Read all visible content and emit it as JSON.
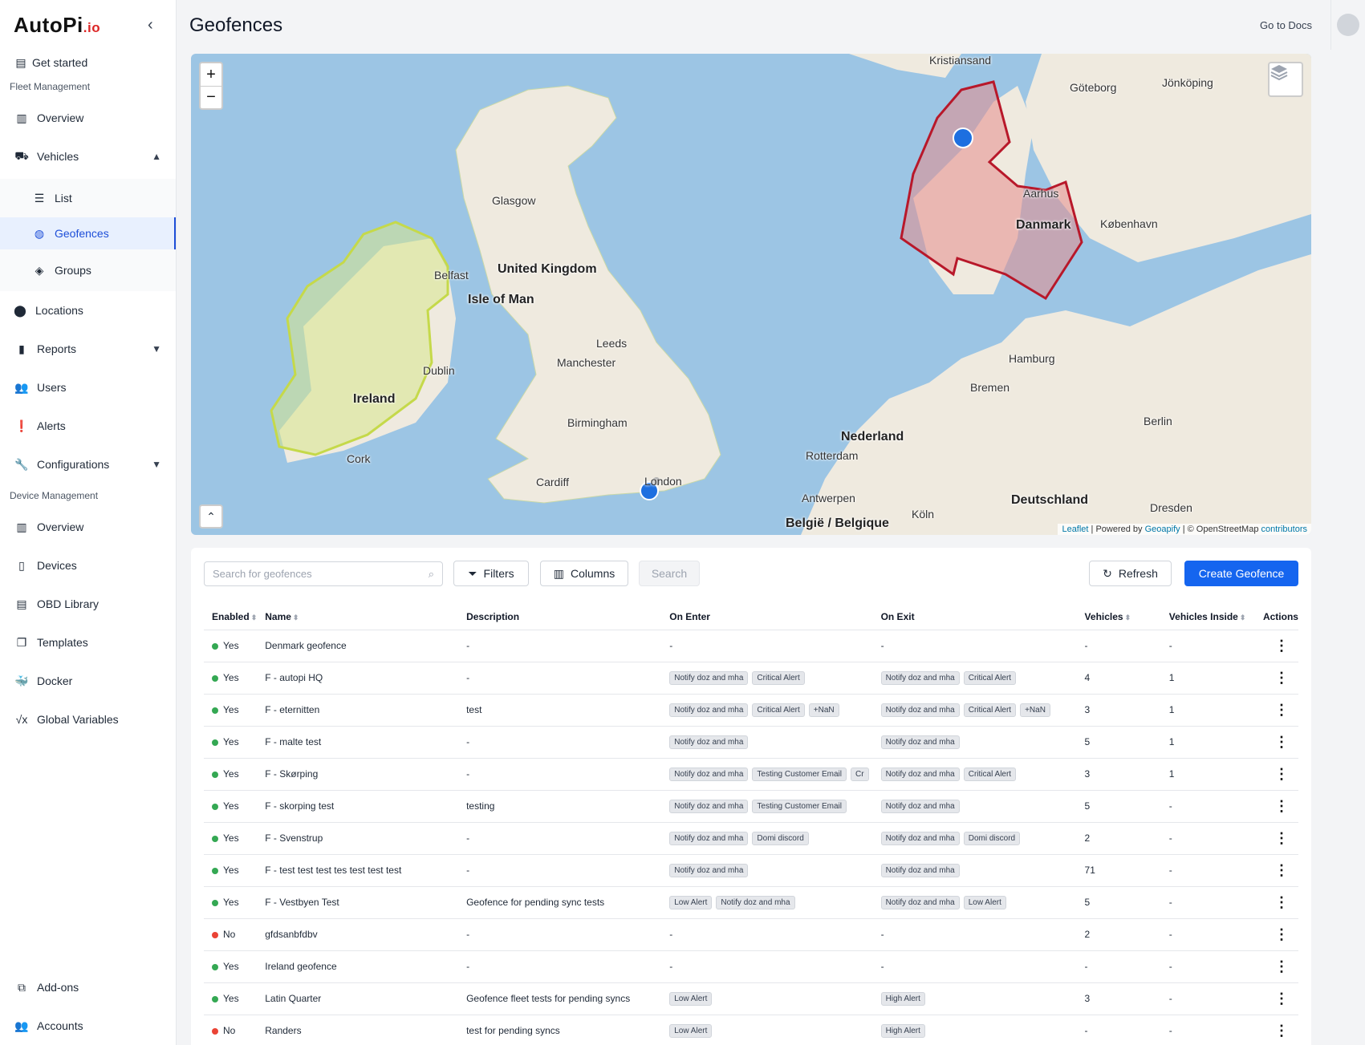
{
  "app": {
    "logo_main": "AutoPi",
    "logo_suffix": ".io"
  },
  "sidebar": {
    "get_started": "Get started",
    "fleet_section": "Fleet Management",
    "fleet_overview": "Overview",
    "vehicles": "Vehicles",
    "list": "List",
    "geofences": "Geofences",
    "groups": "Groups",
    "locations": "Locations",
    "reports": "Reports",
    "users": "Users",
    "alerts": "Alerts",
    "configurations": "Configurations",
    "device_section": "Device Management",
    "device_overview": "Overview",
    "devices": "Devices",
    "obd_library": "OBD Library",
    "templates": "Templates",
    "docker": "Docker",
    "global_variables": "Global Variables",
    "addons": "Add-ons",
    "accounts": "Accounts"
  },
  "header": {
    "title": "Geofences",
    "docs_link": "Go to Docs"
  },
  "map": {
    "zoom_in": "+",
    "zoom_out": "−",
    "attribution": {
      "leaflet": "Leaflet",
      "powered": "| Powered by",
      "geoapify": "Geoapify",
      "osm": "| © OpenStreetMap",
      "contributors": "contributors"
    },
    "labels": {
      "kristiansand": "Kristiansand",
      "goteborg": "Göteborg",
      "jonkoping": "Jönköping",
      "glasgow": "Glasgow",
      "uk": "United Kingdom",
      "belfast": "Belfast",
      "isle_of_man": "Isle of Man",
      "aarhus": "Aarhus",
      "danmark": "Danmark",
      "kobenhavn": "København",
      "leeds": "Leeds",
      "manchester": "Manchester",
      "hamburg": "Hamburg",
      "dublin": "Dublin",
      "ireland": "Ireland",
      "bremen": "Bremen",
      "birmingham": "Birmingham",
      "berlin": "Berlin",
      "nederland": "Nederland",
      "cork": "Cork",
      "rotterdam": "Rotterdam",
      "cardiff": "Cardiff",
      "london": "London",
      "antwerpen": "Antwerpen",
      "deutschland": "Deutschland",
      "dresden": "Dresden",
      "koln": "Köln",
      "belgie": "België / Belgique"
    }
  },
  "toolbar": {
    "search_placeholder": "Search for geofences",
    "filters": "Filters",
    "columns": "Columns",
    "search": "Search",
    "refresh": "Refresh",
    "create": "Create Geofence"
  },
  "table": {
    "headers": {
      "enabled": "Enabled",
      "name": "Name",
      "description": "Description",
      "on_enter": "On Enter",
      "on_exit": "On Exit",
      "vehicles": "Vehicles",
      "vehicles_inside": "Vehicles Inside",
      "actions": "Actions"
    },
    "rows": [
      {
        "enabled": "Yes",
        "status": "green",
        "name": "Denmark geofence",
        "description": "-",
        "on_enter": [],
        "on_enter_text": "-",
        "on_exit": [],
        "on_exit_text": "-",
        "vehicles": "-",
        "inside": "-"
      },
      {
        "enabled": "Yes",
        "status": "green",
        "name": "F - autopi HQ",
        "description": "-",
        "on_enter": [
          "Notify doz and mha",
          "Critical Alert"
        ],
        "on_enter_text": "",
        "on_exit": [
          "Notify doz and mha",
          "Critical Alert"
        ],
        "on_exit_text": "",
        "vehicles": "4",
        "inside": "1"
      },
      {
        "enabled": "Yes",
        "status": "green",
        "name": "F - eternitten",
        "description": "test",
        "on_enter": [
          "Notify doz and mha",
          "Critical Alert",
          "+NaN"
        ],
        "on_enter_text": "",
        "on_exit": [
          "Notify doz and mha",
          "Critical Alert",
          "+NaN"
        ],
        "on_exit_text": "",
        "vehicles": "3",
        "inside": "1"
      },
      {
        "enabled": "Yes",
        "status": "green",
        "name": "F - malte test",
        "description": "-",
        "on_enter": [
          "Notify doz and mha"
        ],
        "on_enter_text": "",
        "on_exit": [
          "Notify doz and mha"
        ],
        "on_exit_text": "",
        "vehicles": "5",
        "inside": "1"
      },
      {
        "enabled": "Yes",
        "status": "green",
        "name": "F - Skørping",
        "description": "-",
        "on_enter": [
          "Notify doz and mha",
          "Testing Customer Email",
          "Cr"
        ],
        "on_enter_text": "",
        "on_exit": [
          "Notify doz and mha",
          "Critical Alert"
        ],
        "on_exit_text": "",
        "vehicles": "3",
        "inside": "1"
      },
      {
        "enabled": "Yes",
        "status": "green",
        "name": "F - skorping test",
        "description": "testing",
        "on_enter": [
          "Notify doz and mha",
          "Testing Customer Email"
        ],
        "on_enter_text": "",
        "on_exit": [
          "Notify doz and mha"
        ],
        "on_exit_text": "",
        "vehicles": "5",
        "inside": "-"
      },
      {
        "enabled": "Yes",
        "status": "green",
        "name": "F - Svenstrup",
        "description": "-",
        "on_enter": [
          "Notify doz and mha",
          "Domi discord"
        ],
        "on_enter_text": "",
        "on_exit": [
          "Notify doz and mha",
          "Domi discord"
        ],
        "on_exit_text": "",
        "vehicles": "2",
        "inside": "-"
      },
      {
        "enabled": "Yes",
        "status": "green",
        "name": "F - test test test tes test test test",
        "description": "-",
        "on_enter": [
          "Notify doz and mha"
        ],
        "on_enter_text": "",
        "on_exit": [
          "Notify doz and mha"
        ],
        "on_exit_text": "",
        "vehicles": "71",
        "inside": "-"
      },
      {
        "enabled": "Yes",
        "status": "green",
        "name": "F - Vestbyen Test",
        "description": "Geofence for pending sync tests",
        "on_enter": [
          "Low Alert",
          "Notify doz and mha"
        ],
        "on_enter_text": "",
        "on_exit": [
          "Notify doz and mha",
          "Low Alert"
        ],
        "on_exit_text": "",
        "vehicles": "5",
        "inside": "-"
      },
      {
        "enabled": "No",
        "status": "red",
        "name": "gfdsanbfdbv",
        "description": "-",
        "on_enter": [],
        "on_enter_text": "-",
        "on_exit": [],
        "on_exit_text": "-",
        "vehicles": "2",
        "inside": "-"
      },
      {
        "enabled": "Yes",
        "status": "green",
        "name": "Ireland geofence",
        "description": "-",
        "on_enter": [],
        "on_enter_text": "-",
        "on_exit": [],
        "on_exit_text": "-",
        "vehicles": "-",
        "inside": "-"
      },
      {
        "enabled": "Yes",
        "status": "green",
        "name": "Latin Quarter",
        "description": "Geofence fleet tests for pending syncs",
        "on_enter": [
          "Low Alert"
        ],
        "on_enter_text": "",
        "on_exit": [
          "High Alert"
        ],
        "on_exit_text": "",
        "vehicles": "3",
        "inside": "-"
      },
      {
        "enabled": "No",
        "status": "red",
        "name": "Randers",
        "description": "test for pending syncs",
        "on_enter": [
          "Low Alert"
        ],
        "on_enter_text": "",
        "on_exit": [
          "High Alert"
        ],
        "on_exit_text": "",
        "vehicles": "-",
        "inside": "-"
      }
    ]
  },
  "colors": {
    "status_green": "#34a853",
    "status_red": "#ea4335",
    "accent": "#1565ef",
    "water": "#9cc5e4",
    "land": "#efeadf"
  }
}
